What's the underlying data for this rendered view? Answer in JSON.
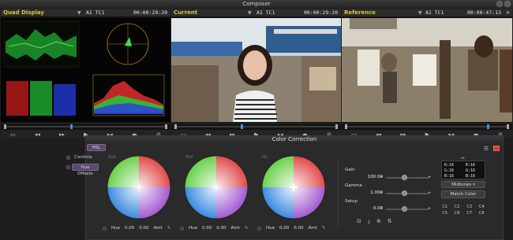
{
  "window": {
    "title": "Composer"
  },
  "panels": [
    {
      "name": "Quad Display",
      "track": "A1 TC1",
      "timecode": "00:00:29:20"
    },
    {
      "name": "Current",
      "track": "A1 TC1",
      "timecode": "00:00:29:20"
    },
    {
      "name": "Reference",
      "track": "A1 TC1",
      "timecode": "00:00:47:13"
    }
  ],
  "transport": {
    "icons": [
      "monitor-icon",
      "step-back-icon",
      "step-forward-icon",
      "play-icon",
      "mark-in-icon",
      "mark-out-icon",
      "no-entry-icon"
    ]
  },
  "color_correction": {
    "title": "Color Correction",
    "tab": "HSL",
    "controls_label": "Controls",
    "hue_offsets_label": "Hue Offsets",
    "wheels": [
      {
        "label": "Shd",
        "hue_label": "Hue",
        "hue_value": "0.00",
        "amt_value": "0.00",
        "amt_label": "Amt"
      },
      {
        "label": "Mid",
        "hue_label": "Hue",
        "hue_value": "0.00",
        "amt_value": "0.00",
        "amt_label": "Amt"
      },
      {
        "label": "Hil",
        "hue_label": "Hue",
        "hue_value": "0.00",
        "amt_value": "0.00",
        "amt_label": "Amt"
      }
    ],
    "sliders": [
      {
        "label": "Gain",
        "value": "100.00",
        "level": 0.6
      },
      {
        "label": "Gamma",
        "value": "1.000",
        "level": 0.6
      },
      {
        "label": "Setup",
        "value": "0.00",
        "level": 0.6
      }
    ],
    "rgb": {
      "left": [
        "R:16",
        "G:16",
        "B:16"
      ],
      "right": [
        "R:16",
        "G:16",
        "B:16"
      ]
    },
    "midtones_label": "Midtones",
    "match_color_label": "Match Color",
    "color_buttons": [
      "C1",
      "C2",
      "C3",
      "C4",
      "C5",
      "C6",
      "C7",
      "C8"
    ]
  }
}
